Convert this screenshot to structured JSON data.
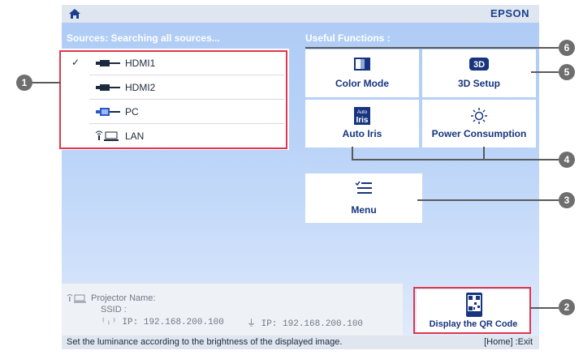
{
  "header": {
    "brand": "EPSON"
  },
  "sources": {
    "title": "Sources: Searching all sources...",
    "items": [
      {
        "label": "HDMI1",
        "selected": true,
        "check": "✓"
      },
      {
        "label": "HDMI2",
        "selected": false,
        "check": ""
      },
      {
        "label": "PC",
        "selected": false,
        "check": ""
      },
      {
        "label": "LAN",
        "selected": false,
        "check": ""
      }
    ]
  },
  "useful": {
    "title": "Useful Functions :",
    "buttons": [
      {
        "label": "Color Mode",
        "icon": "color-mode-icon"
      },
      {
        "label": "3D Setup",
        "icon": "3d-icon"
      },
      {
        "label": "Auto Iris",
        "icon": "auto-iris-icon"
      },
      {
        "label": "Power Consumption",
        "icon": "sun-icon"
      },
      {
        "label": "Menu",
        "icon": "menu-icon"
      }
    ]
  },
  "network": {
    "name_label": "Projector Name:",
    "ssid_label": "SSID :",
    "wifi_ip": "IP: 192.168.200.100",
    "wired_ip": "IP: 192.168.200.100"
  },
  "qr": {
    "label": "Display the QR Code"
  },
  "footer": {
    "hint": "Set the luminance according to the brightness of the displayed image.",
    "exit": "[Home] :Exit"
  },
  "callouts": [
    "1",
    "2",
    "3",
    "4",
    "5",
    "6"
  ],
  "colors": {
    "accent": "#16357e",
    "highlight": "#e0364d",
    "background": "#b9d3f8"
  }
}
